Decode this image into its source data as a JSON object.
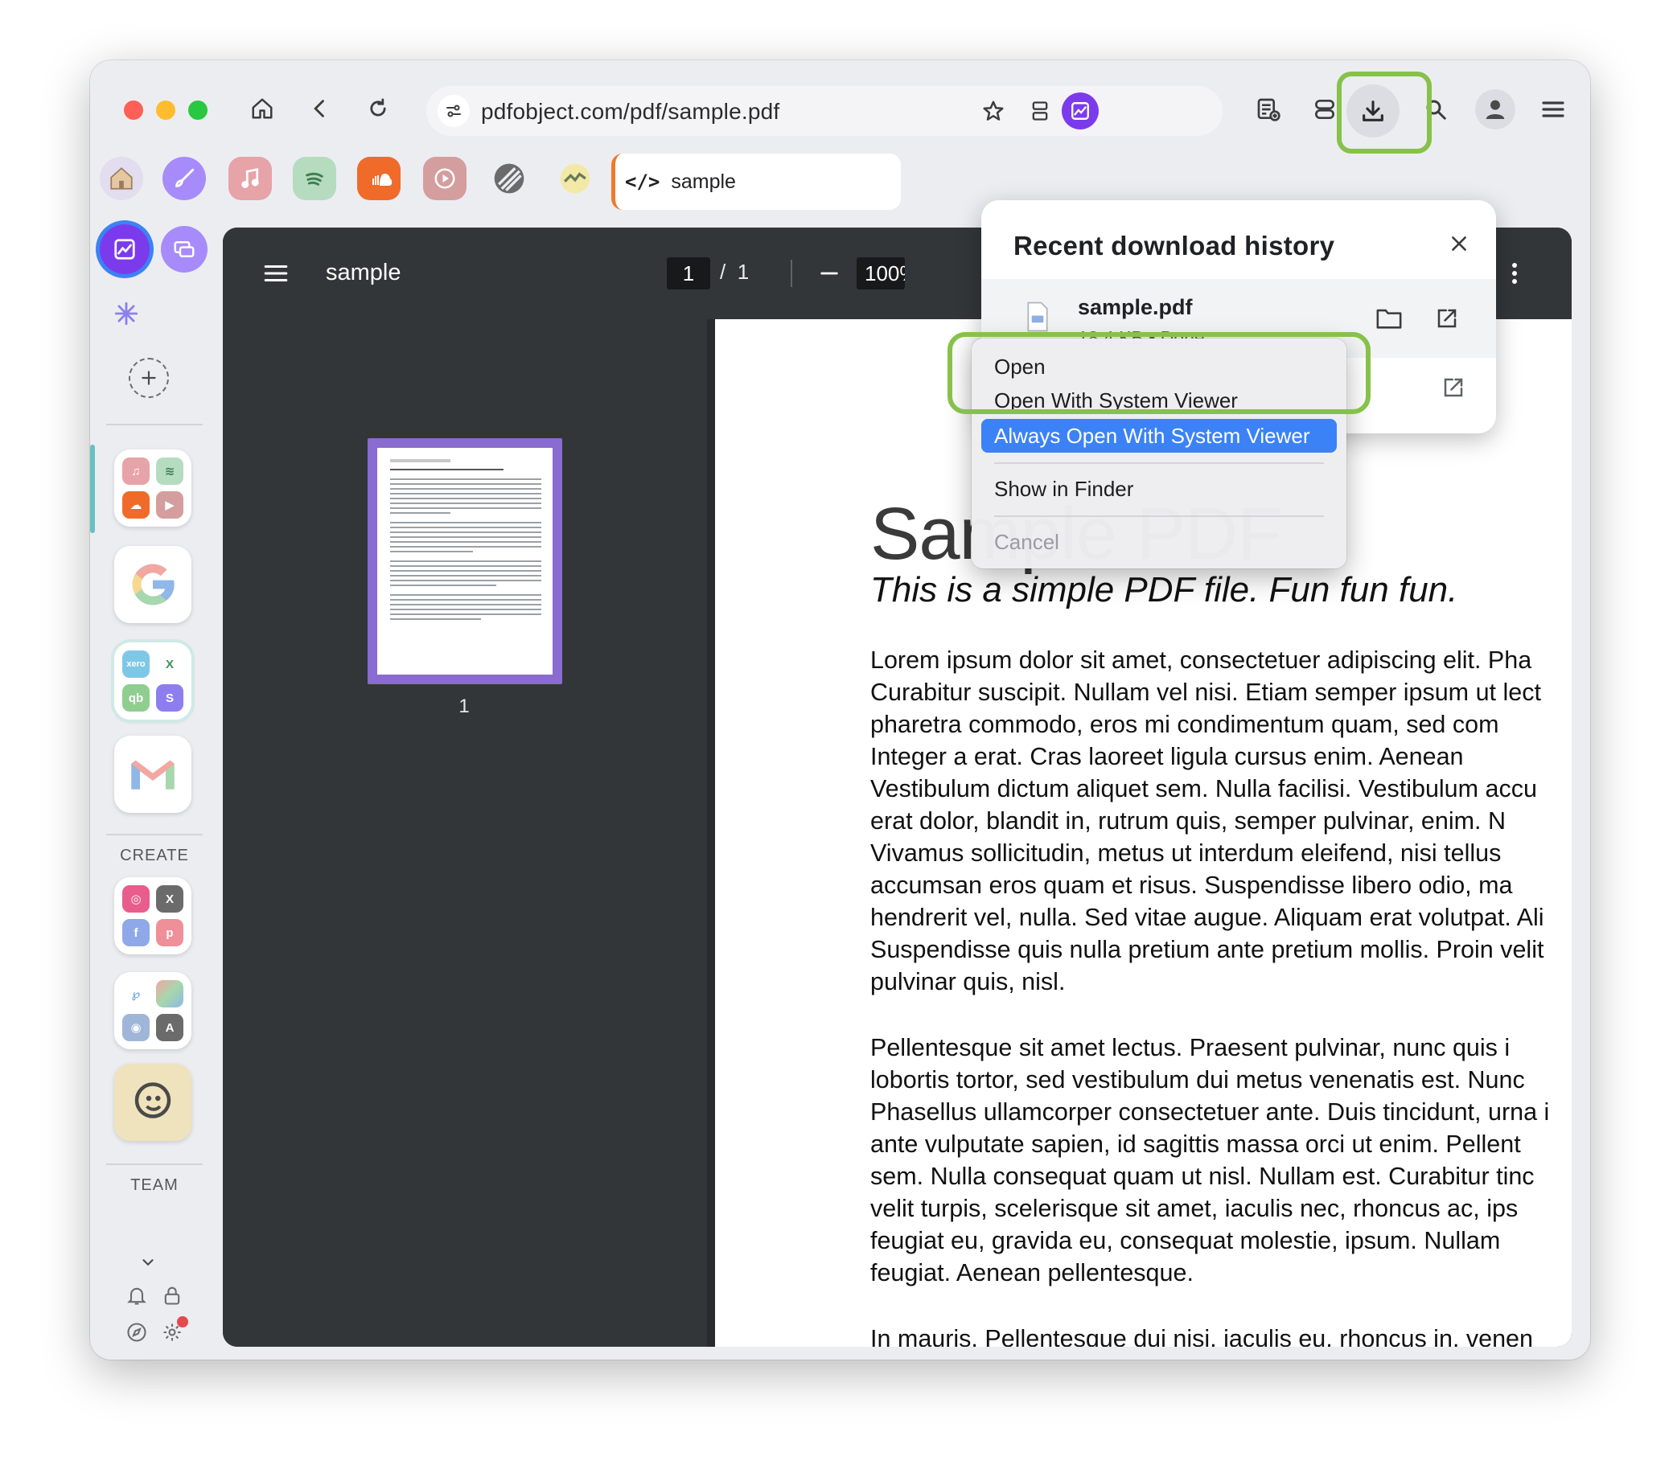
{
  "browser": {
    "url": "pdfobject.com/pdf/sample.pdf",
    "tab_label": "sample",
    "tab_icon": "code-icon"
  },
  "colors": {
    "accent_purple": "#8a6bd1",
    "selection_blue": "#3b82f6",
    "highlight_green": "#86c24a",
    "tab_accent": "#f07a2c"
  },
  "sidebar": {
    "create_label": "CREATE",
    "team_label": "TEAM"
  },
  "viewer": {
    "title": "sample",
    "page_current": "1",
    "page_sep": "/",
    "page_total": "1",
    "zoom": "100%",
    "thumb_page_number": "1"
  },
  "pdf": {
    "title": "Sample PDF",
    "subtitle": "This is a simple PDF file. Fun fun fun.",
    "para1": [
      "Lorem ipsum dolor sit amet, consectetuer adipiscing elit. Pha",
      "Curabitur suscipit. Nullam vel nisi. Etiam semper ipsum ut lect",
      "pharetra commodo, eros mi condimentum quam, sed com",
      "Integer a erat. Cras laoreet ligula cursus enim. Aenean",
      "Vestibulum dictum aliquet sem. Nulla facilisi. Vestibulum accu",
      "erat dolor, blandit in, rutrum quis, semper pulvinar, enim. N",
      "Vivamus sollicitudin, metus ut interdum eleifend, nisi tellus",
      "accumsan eros quam et risus. Suspendisse libero odio, ma",
      "hendrerit vel, nulla. Sed vitae augue. Aliquam erat volutpat. Ali",
      "Suspendisse quis nulla pretium ante pretium mollis. Proin velit",
      "pulvinar quis, nisl."
    ],
    "para2": [
      "Pellentesque sit amet lectus. Praesent pulvinar, nunc quis i",
      "lobortis tortor, sed vestibulum dui metus venenatis est. Nunc",
      "Phasellus ullamcorper consectetuer ante. Duis tincidunt, urna i",
      "ante vulputate sapien, id sagittis massa orci ut enim. Pellent",
      "sem. Nulla consequat quam ut nisl. Nullam est. Curabitur tinc",
      "velit turpis, scelerisque sit amet, iaculis nec, rhoncus ac, ips",
      "feugiat eu, gravida eu, consequat molestie, ipsum. Nullam",
      "feugiat. Aenean pellentesque."
    ],
    "para3_partial": "In mauris. Pellentesque dui nisi, iaculis eu, rhoncus in, venen"
  },
  "downloads": {
    "title": "Recent download history",
    "item_name": "sample.pdf",
    "item_meta": "18.4 KB • Done"
  },
  "context_menu": {
    "items": [
      "Open",
      "Open With System Viewer",
      "Always Open With System Viewer",
      "Show in Finder",
      "Cancel"
    ],
    "selected_index": 2,
    "disabled_index": 4
  }
}
